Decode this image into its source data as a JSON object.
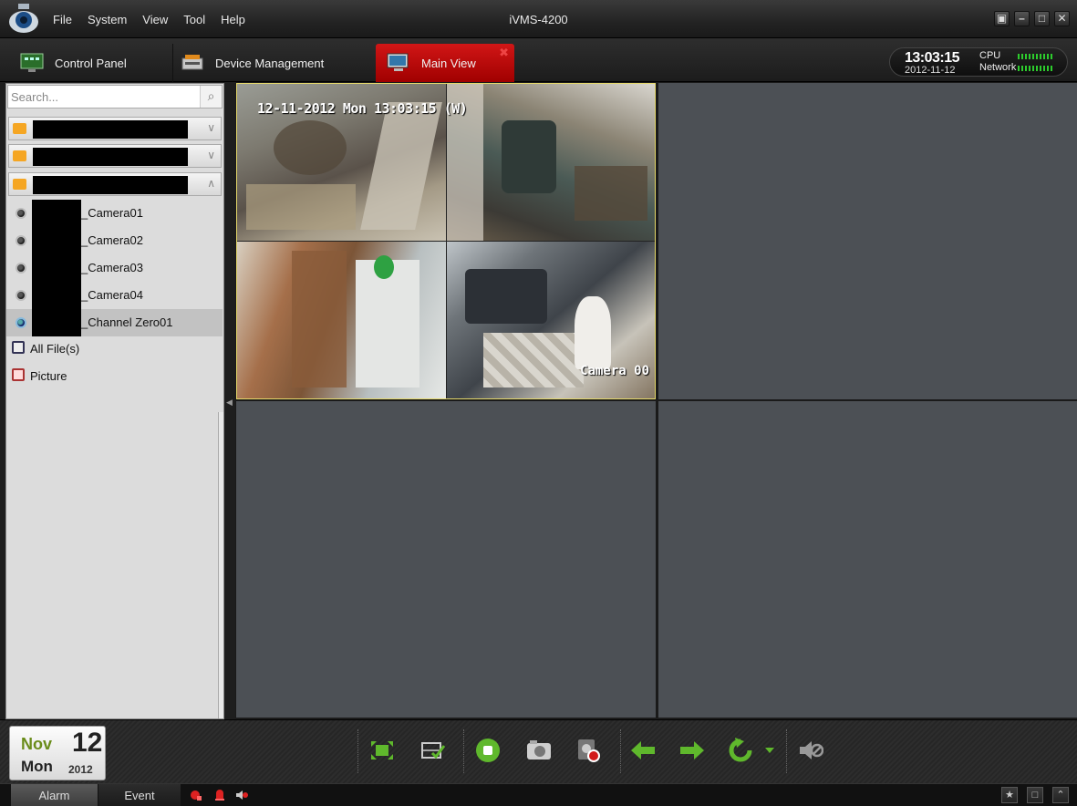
{
  "app": {
    "title": "iVMS-4200"
  },
  "menu": [
    "File",
    "System",
    "View",
    "Tool",
    "Help"
  ],
  "tabs": [
    {
      "label": "Control Panel"
    },
    {
      "label": "Device Management"
    },
    {
      "label": "Main View",
      "active": true
    }
  ],
  "clock": {
    "time": "13:03:15",
    "date": "2012-11-12"
  },
  "meters": {
    "cpu_label": "CPU",
    "network_label": "Network"
  },
  "sidebar": {
    "search_placeholder": "Search...",
    "groups": [
      {
        "expanded": false
      },
      {
        "expanded": false
      },
      {
        "expanded": true
      }
    ],
    "cameras": [
      {
        "label": "_Camera01"
      },
      {
        "label": "_Camera02"
      },
      {
        "label": "_Camera03"
      },
      {
        "label": "_Camera04"
      },
      {
        "label": "_Channel Zero01",
        "selected": true
      }
    ],
    "files": [
      {
        "label": "All File(s)"
      },
      {
        "label": "Picture"
      }
    ]
  },
  "video": {
    "osd_time": "12-11-2012 Mon 13:03:15 (W)",
    "osd_camera": "Camera 00"
  },
  "date": {
    "month": "Nov",
    "day": "12",
    "weekday": "Mon",
    "year": "2012"
  },
  "statusbar": {
    "alarm": "Alarm",
    "event": "Event"
  },
  "colors": {
    "accent_red": "#c40000",
    "toolbar_green": "#5fb82c",
    "selected_pane_border": "#e6d96a"
  }
}
